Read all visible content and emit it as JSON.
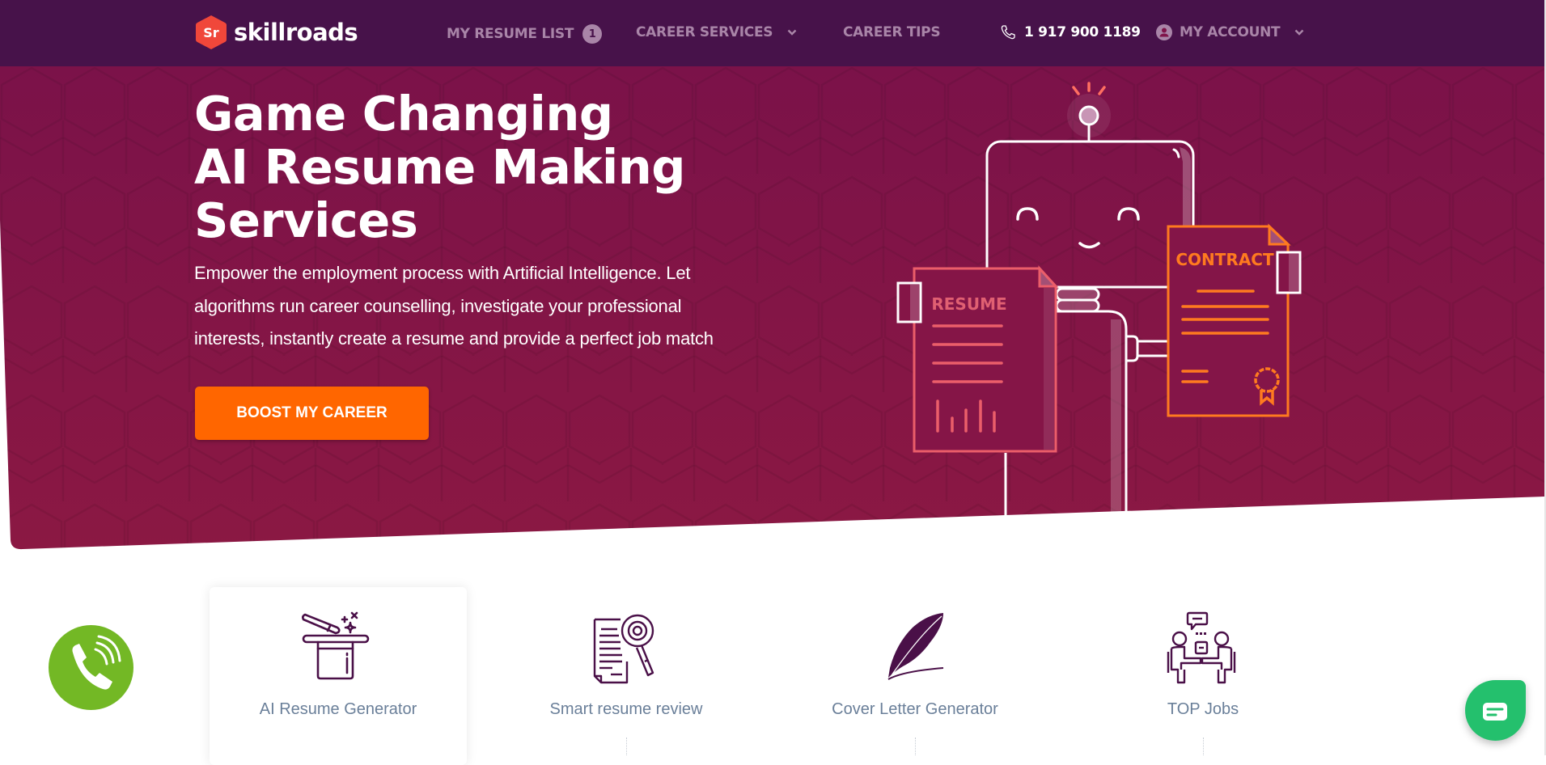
{
  "header": {
    "logo_mark": "Sr",
    "logo_text": "skillroads",
    "nav": {
      "resume_list": "MY RESUME LIST",
      "resume_list_count": "1",
      "career_services": "CAREER SERVICES",
      "career_tips": "CAREER TIPS",
      "phone": "1 917 900 1189",
      "account": "MY ACCOUNT"
    }
  },
  "hero": {
    "title_lines": [
      "Game Changing",
      "AI Resume Making",
      "Services"
    ],
    "description_lines": [
      "Empower the employment process with Artificial Intelligence. Let",
      "algorithms run career counselling, investigate your professional",
      "interests, instantly create a resume and provide a perfect job match"
    ],
    "cta_label": "BOOST MY CAREER",
    "illustration": {
      "resume_label": "RESUME",
      "contract_label": "CONTRACT"
    }
  },
  "services": [
    {
      "label": "AI Resume Generator",
      "icon": "magic-hat-icon",
      "active": true
    },
    {
      "label": "Smart resume review",
      "icon": "document-magnifier-icon",
      "active": false
    },
    {
      "label": "Cover Letter Generator",
      "icon": "quill-pen-icon",
      "active": false
    },
    {
      "label": "TOP Jobs",
      "icon": "interview-icon",
      "active": false
    }
  ],
  "floating": {
    "call_button": "phone-call-icon",
    "chat_button": "chat-icon"
  },
  "colors": {
    "header_bg": "#47124a",
    "hero_bg": "#7f1349",
    "accent_orange": "#ff6600",
    "nav_text": "#a985a8",
    "call_green": "#73b825",
    "chat_green": "#24c06d",
    "icon_purple": "#4a1048",
    "service_label": "#6a7f99"
  }
}
